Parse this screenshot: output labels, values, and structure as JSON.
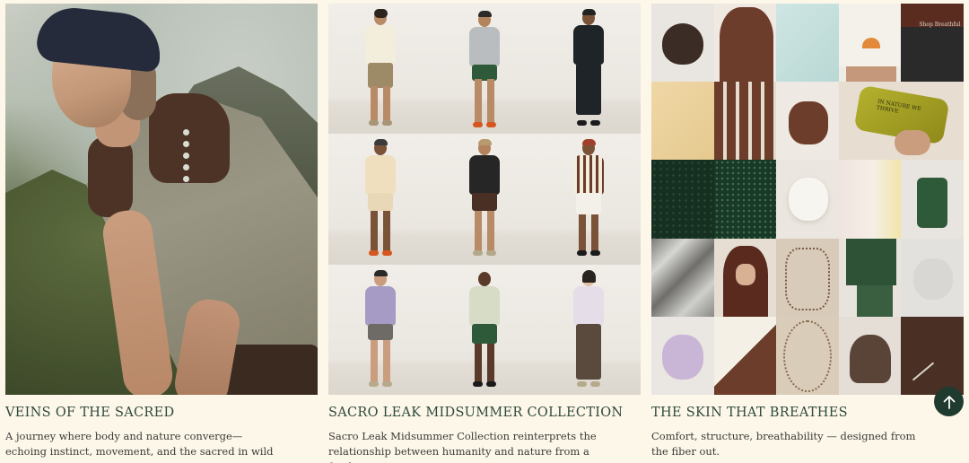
{
  "collections": [
    {
      "title": "VEINS OF THE SACRED",
      "description": "A journey where body and nature converge—echoing instinct, movement, and the sacred in wild terrains."
    },
    {
      "title": "SACRO LEAK MIDSUMMER COLLECTION",
      "description": "Sacro Leak Midsummer Collection reinterprets the relationship between humanity and nature from a fresh"
    },
    {
      "title": "THE SKIN THAT BREATHES",
      "description": "Comfort, structure, breathability — designed from the fiber out."
    }
  ],
  "hero_shorts_print": "IN NATURE WE THRIVE",
  "pouch_print": "IN NATURE WE THRIVE",
  "tag_text": "Shop Breathful",
  "scroll_top": {
    "icon": "arrow-up-icon"
  },
  "colors": {
    "background": "#fdf7ea",
    "title": "#2f4a3c",
    "scroll_button": "#1f3b30"
  }
}
